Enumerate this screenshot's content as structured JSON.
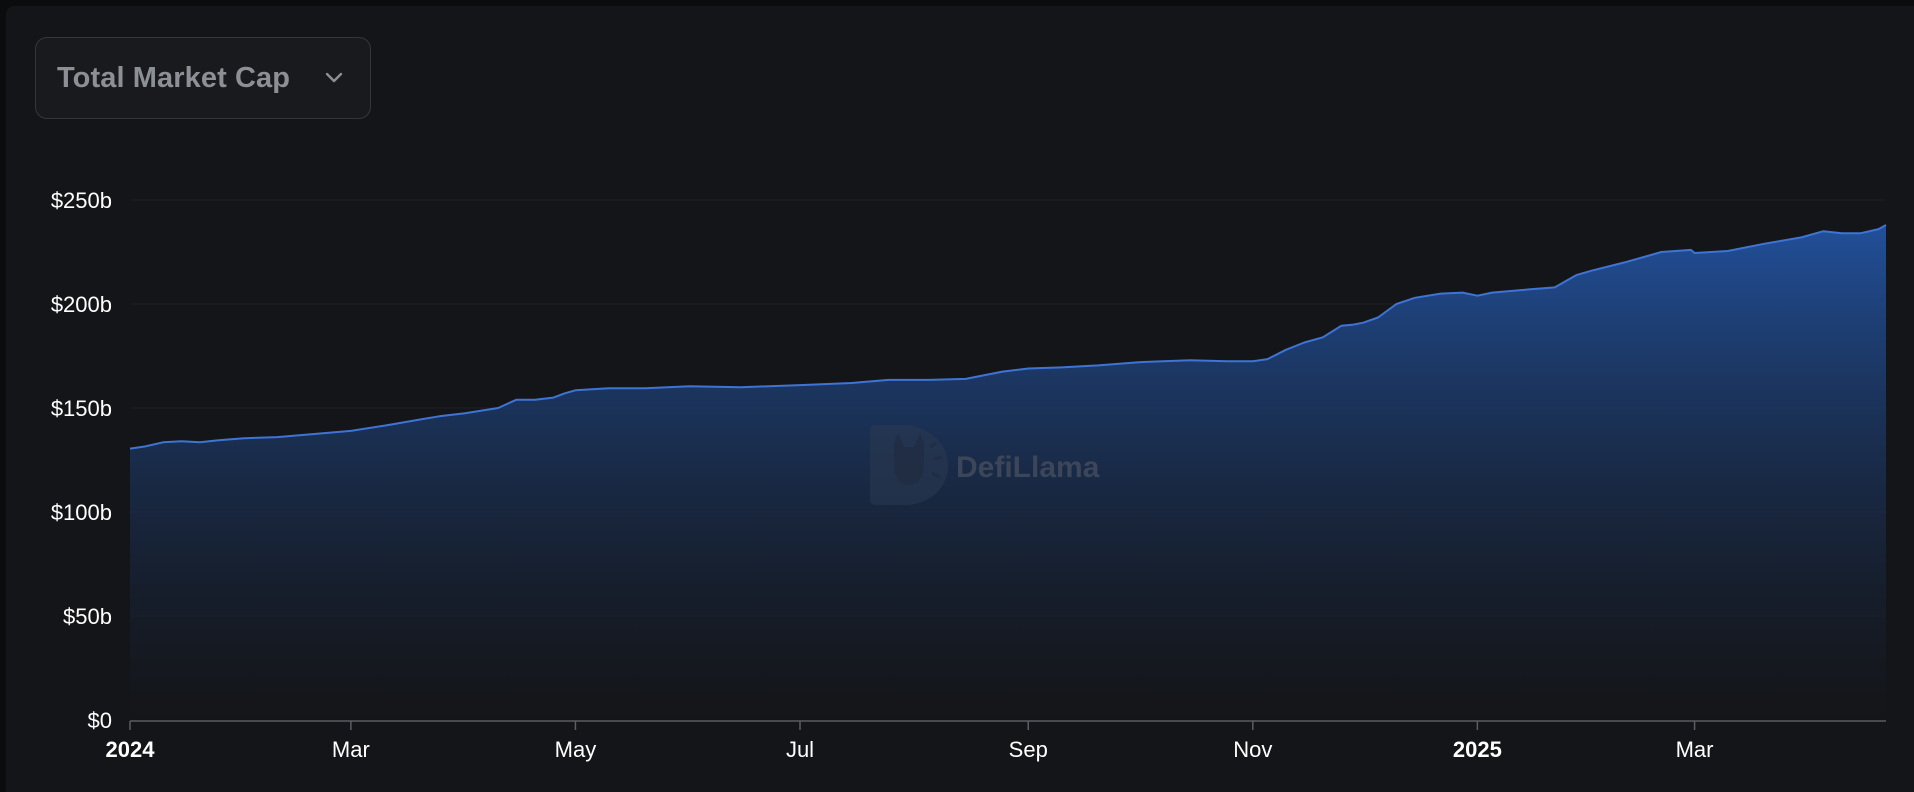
{
  "metric_selector": {
    "label": "Total Market Cap",
    "icon": "chevron-down-icon"
  },
  "watermark": {
    "text": "DefiLlama"
  },
  "colors": {
    "background": "#141518",
    "line": "#3d74d6",
    "fill_top": "#2356a8",
    "fill_bottom": "#141518",
    "axis": "#5a5d63",
    "grid": "#1e2024",
    "text": "#ffffff"
  },
  "chart_data": {
    "type": "area",
    "title": "",
    "xlabel": "",
    "ylabel": "",
    "x_unit": "date",
    "xlim": [
      "2024-01-01",
      "2025-04-22"
    ],
    "ylim": [
      0,
      250
    ],
    "y_ticks": [
      "$0",
      "$50b",
      "$100b",
      "$150b",
      "$200b",
      "$250b"
    ],
    "y_tick_values": [
      0,
      50,
      100,
      150,
      200,
      250
    ],
    "x_ticks": [
      {
        "label": "2024",
        "date": "2024-01-01",
        "bold": true
      },
      {
        "label": "Mar",
        "date": "2024-03-01",
        "bold": false
      },
      {
        "label": "May",
        "date": "2024-05-01",
        "bold": false
      },
      {
        "label": "Jul",
        "date": "2024-07-01",
        "bold": false
      },
      {
        "label": "Sep",
        "date": "2024-09-01",
        "bold": false
      },
      {
        "label": "Nov",
        "date": "2024-11-01",
        "bold": false
      },
      {
        "label": "2025",
        "date": "2025-01-01",
        "bold": true
      },
      {
        "label": "Mar",
        "date": "2025-03-01",
        "bold": false
      }
    ],
    "grid": true,
    "legend": "none",
    "series": [
      {
        "values": [
          [
            "2024-01-01",
            130.5
          ],
          [
            "2024-01-05",
            131.5
          ],
          [
            "2024-01-10",
            133.5
          ],
          [
            "2024-01-15",
            134
          ],
          [
            "2024-01-20",
            133.5
          ],
          [
            "2024-01-25",
            134.5
          ],
          [
            "2024-02-01",
            135.5
          ],
          [
            "2024-02-10",
            136
          ],
          [
            "2024-02-20",
            137.5
          ],
          [
            "2024-03-01",
            139
          ],
          [
            "2024-03-10",
            141.5
          ],
          [
            "2024-03-20",
            144.5
          ],
          [
            "2024-03-25",
            146
          ],
          [
            "2024-04-01",
            147.5
          ],
          [
            "2024-04-10",
            150
          ],
          [
            "2024-04-15",
            154
          ],
          [
            "2024-04-20",
            154
          ],
          [
            "2024-04-25",
            155
          ],
          [
            "2024-04-28",
            157
          ],
          [
            "2024-05-01",
            158.5
          ],
          [
            "2024-05-10",
            159.5
          ],
          [
            "2024-05-20",
            159.5
          ],
          [
            "2024-06-01",
            160.5
          ],
          [
            "2024-06-15",
            160
          ],
          [
            "2024-07-01",
            161
          ],
          [
            "2024-07-15",
            162
          ],
          [
            "2024-07-25",
            163.5
          ],
          [
            "2024-08-05",
            163.5
          ],
          [
            "2024-08-15",
            164
          ],
          [
            "2024-08-25",
            167.5
          ],
          [
            "2024-09-01",
            169
          ],
          [
            "2024-09-10",
            169.5
          ],
          [
            "2024-09-20",
            170.5
          ],
          [
            "2024-10-01",
            172
          ],
          [
            "2024-10-15",
            173
          ],
          [
            "2024-10-25",
            172.5
          ],
          [
            "2024-11-01",
            172.5
          ],
          [
            "2024-11-05",
            173.5
          ],
          [
            "2024-11-10",
            178
          ],
          [
            "2024-11-15",
            181.5
          ],
          [
            "2024-11-20",
            184
          ],
          [
            "2024-11-25",
            189.5
          ],
          [
            "2024-11-28",
            190
          ],
          [
            "2024-12-01",
            191
          ],
          [
            "2024-12-05",
            193.5
          ],
          [
            "2024-12-10",
            200
          ],
          [
            "2024-12-15",
            203
          ],
          [
            "2024-12-22",
            205
          ],
          [
            "2024-12-28",
            205.5
          ],
          [
            "2025-01-01",
            204
          ],
          [
            "2025-01-05",
            205.5
          ],
          [
            "2025-01-15",
            207
          ],
          [
            "2025-01-22",
            208
          ],
          [
            "2025-01-28",
            214
          ],
          [
            "2025-02-01",
            216
          ],
          [
            "2025-02-10",
            220
          ],
          [
            "2025-02-20",
            225
          ],
          [
            "2025-02-28",
            226
          ],
          [
            "2025-03-01",
            224.5
          ],
          [
            "2025-03-10",
            225.5
          ],
          [
            "2025-03-20",
            229
          ],
          [
            "2025-03-30",
            232
          ],
          [
            "2025-04-05",
            235
          ],
          [
            "2025-04-10",
            234
          ],
          [
            "2025-04-15",
            234
          ],
          [
            "2025-04-20",
            236
          ],
          [
            "2025-04-22",
            238
          ]
        ]
      }
    ]
  }
}
